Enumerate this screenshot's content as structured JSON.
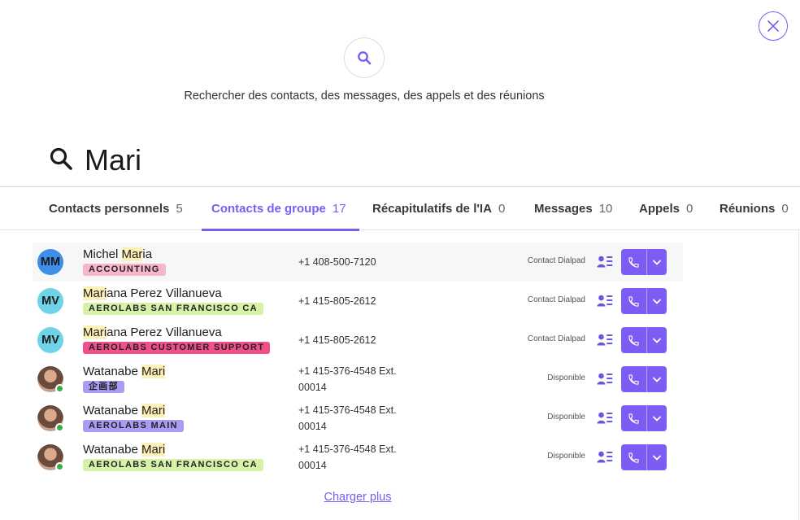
{
  "header": {
    "subtitle": "Rechercher des contacts, des messages, des appels et des réunions"
  },
  "search": {
    "query": "Mari"
  },
  "tabs": [
    {
      "label": "Contacts personnels",
      "count": "5"
    },
    {
      "label": "Contacts de groupe",
      "count": "17",
      "active": true
    },
    {
      "label": "Récapitulatifs de l'IA",
      "count": "0"
    },
    {
      "label": "Messages",
      "count": "10"
    },
    {
      "label": "Appels",
      "count": "0"
    },
    {
      "label": "Réunions",
      "count": "0"
    }
  ],
  "results": [
    {
      "name_parts": [
        "Michel ",
        "Mar",
        "i",
        "a"
      ],
      "initials": "MM",
      "avatar_color": "#3d8fe8",
      "tag": "ACCOUNTING",
      "tag_bg": "#f7b6ca",
      "phone_line1": "+1 408-500-7120",
      "phone_line2": "",
      "status": "Contact Dialpad"
    },
    {
      "name_parts": [
        "",
        "Mari",
        "ana Perez Villanueva",
        ""
      ],
      "initials": "MV",
      "avatar_color": "#6fd3ea",
      "tag": "AEROLABS SAN FRANCISCO CA",
      "tag_bg": "#d6f2a8",
      "phone_line1": "+1 415-805-2612",
      "phone_line2": "",
      "status": "Contact Dialpad"
    },
    {
      "name_parts": [
        "",
        "Mari",
        "ana Perez Villanueva",
        ""
      ],
      "initials": "MV",
      "avatar_color": "#6fd3ea",
      "tag": "AEROLABS CUSTOMER SUPPORT",
      "tag_bg": "#f0508a",
      "phone_line1": "+1 415-805-2612",
      "phone_line2": "",
      "status": "Contact Dialpad"
    },
    {
      "name_parts": [
        "Watanabe ",
        "Mari",
        "",
        ""
      ],
      "initials": "",
      "avatar_color": "",
      "tag": "企画部",
      "tag_bg": "#a99cf5",
      "phone_line1": "+1 415-376-4548 Ext.",
      "phone_line2": "00014",
      "status": "Disponible"
    },
    {
      "name_parts": [
        "Watanabe ",
        "Mari",
        "",
        ""
      ],
      "initials": "",
      "avatar_color": "",
      "tag": "AEROLABS MAIN",
      "tag_bg": "#a99cf5",
      "phone_line1": "+1 415-376-4548 Ext.",
      "phone_line2": "00014",
      "status": "Disponible"
    },
    {
      "name_parts": [
        "Watanabe ",
        "Mari",
        "",
        ""
      ],
      "initials": "",
      "avatar_color": "",
      "tag": "AEROLABS SAN FRANCISCO CA",
      "tag_bg": "#d6f2a8",
      "phone_line1": "+1 415-376-4548 Ext.",
      "phone_line2": "00014",
      "status": "Disponible"
    }
  ],
  "footer": {
    "load_more": "Charger plus"
  },
  "icons": {
    "close": "close-icon",
    "hero": "search-icon",
    "search": "search-icon",
    "contact_card": "contact-card-icon",
    "call": "phone-icon",
    "dropdown": "chevron-down-icon"
  },
  "colors": {
    "accent": "#7c5cf2",
    "highlight": "#fbf0b8",
    "presence": "#2fb344"
  }
}
